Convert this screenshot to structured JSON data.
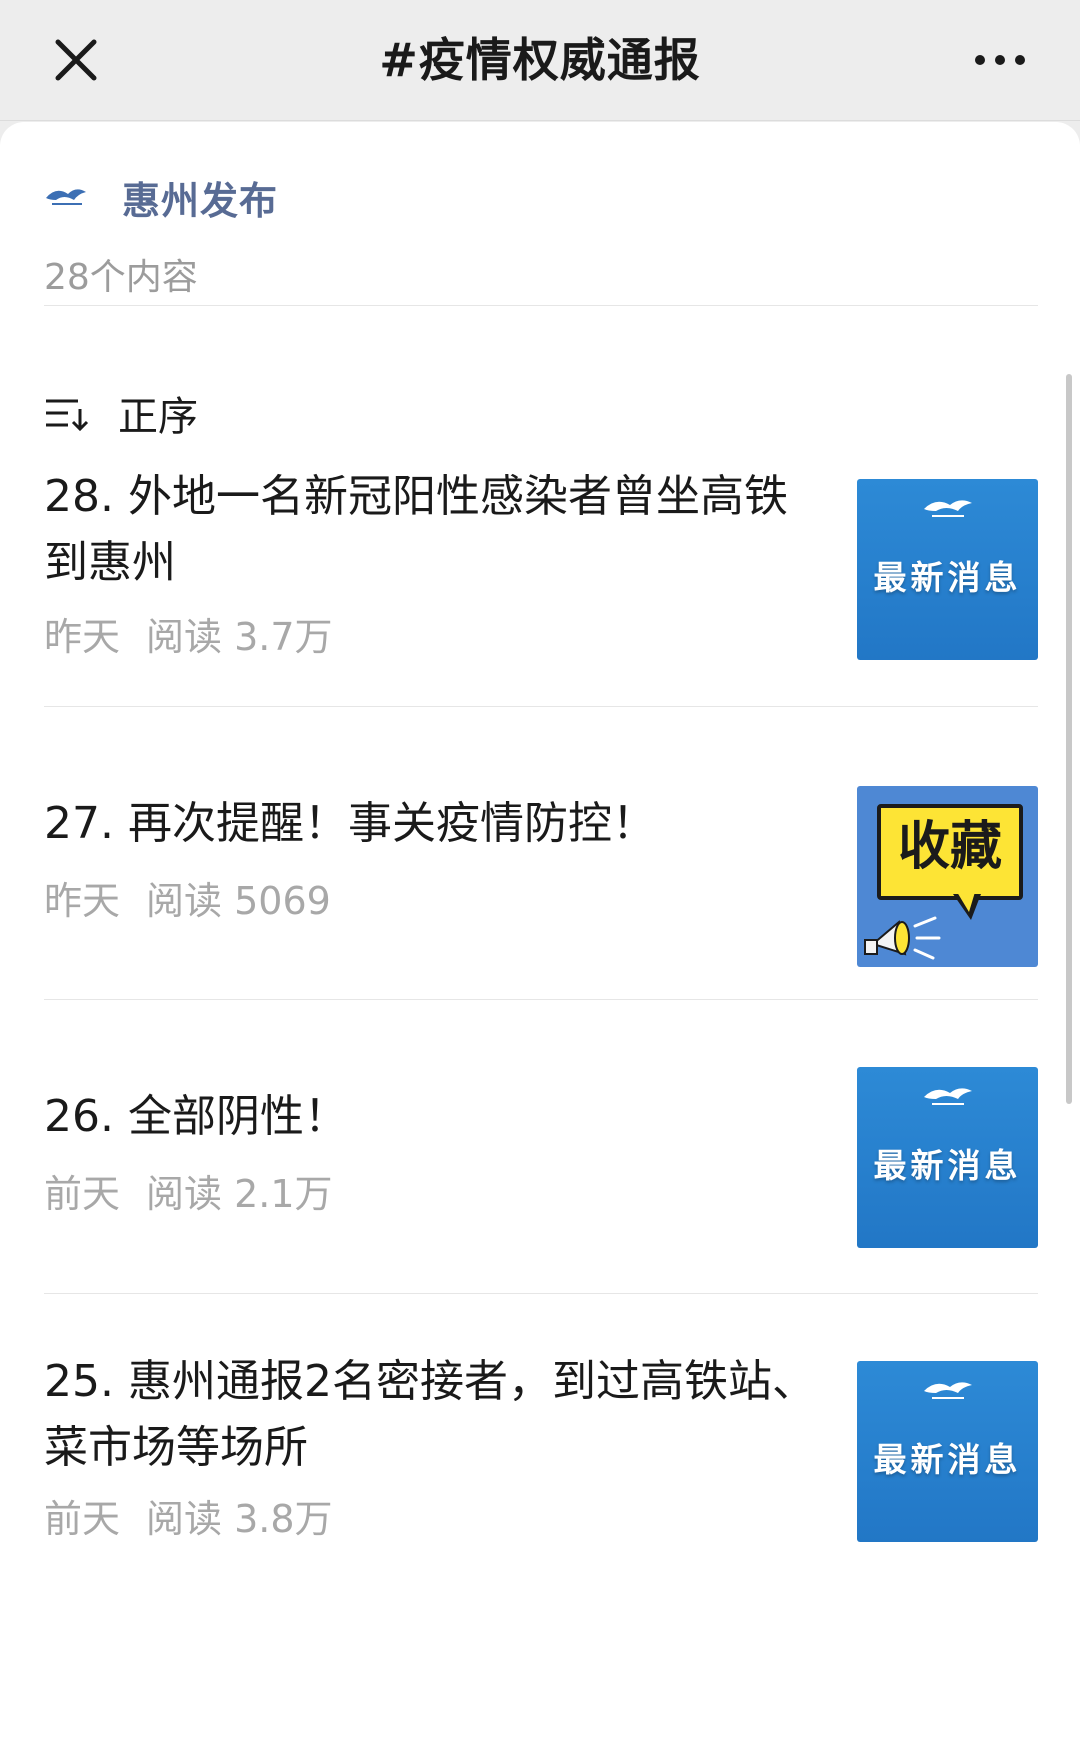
{
  "topbar": {
    "title": "#疫情权威通报",
    "close_icon": "close-icon",
    "more_icon": "more-icon"
  },
  "account": {
    "name": "惠州发布",
    "content_count": "28个内容",
    "logo_icon": "account-logo-icon"
  },
  "sort": {
    "label": "正序",
    "icon": "sort-order-icon"
  },
  "articles": [
    {
      "title": "28. 外地一名新冠阳性感染者曾坐高铁到惠州",
      "date": "昨天",
      "views": "阅读 3.7万",
      "thumb_text": "最新消息"
    },
    {
      "title": "27. 再次提醒！事关疫情防控！",
      "date": "昨天",
      "views": "阅读 5069",
      "thumb_text": "收藏"
    },
    {
      "title": "26. 全部阴性！",
      "date": "前天",
      "views": "阅读 2.1万",
      "thumb_text": "最新消息"
    },
    {
      "title": "25. 惠州通报2名密接者，到过高铁站、菜市场等场所",
      "date": "前天",
      "views": "阅读 3.8万",
      "thumb_text": "最新消息"
    }
  ],
  "colors": {
    "background": "#ededed",
    "account_name": "#586b94",
    "meta_gray": "#a8a8a8",
    "thumb_blue": "#2a84d2",
    "fav_yellow": "#fde435"
  }
}
